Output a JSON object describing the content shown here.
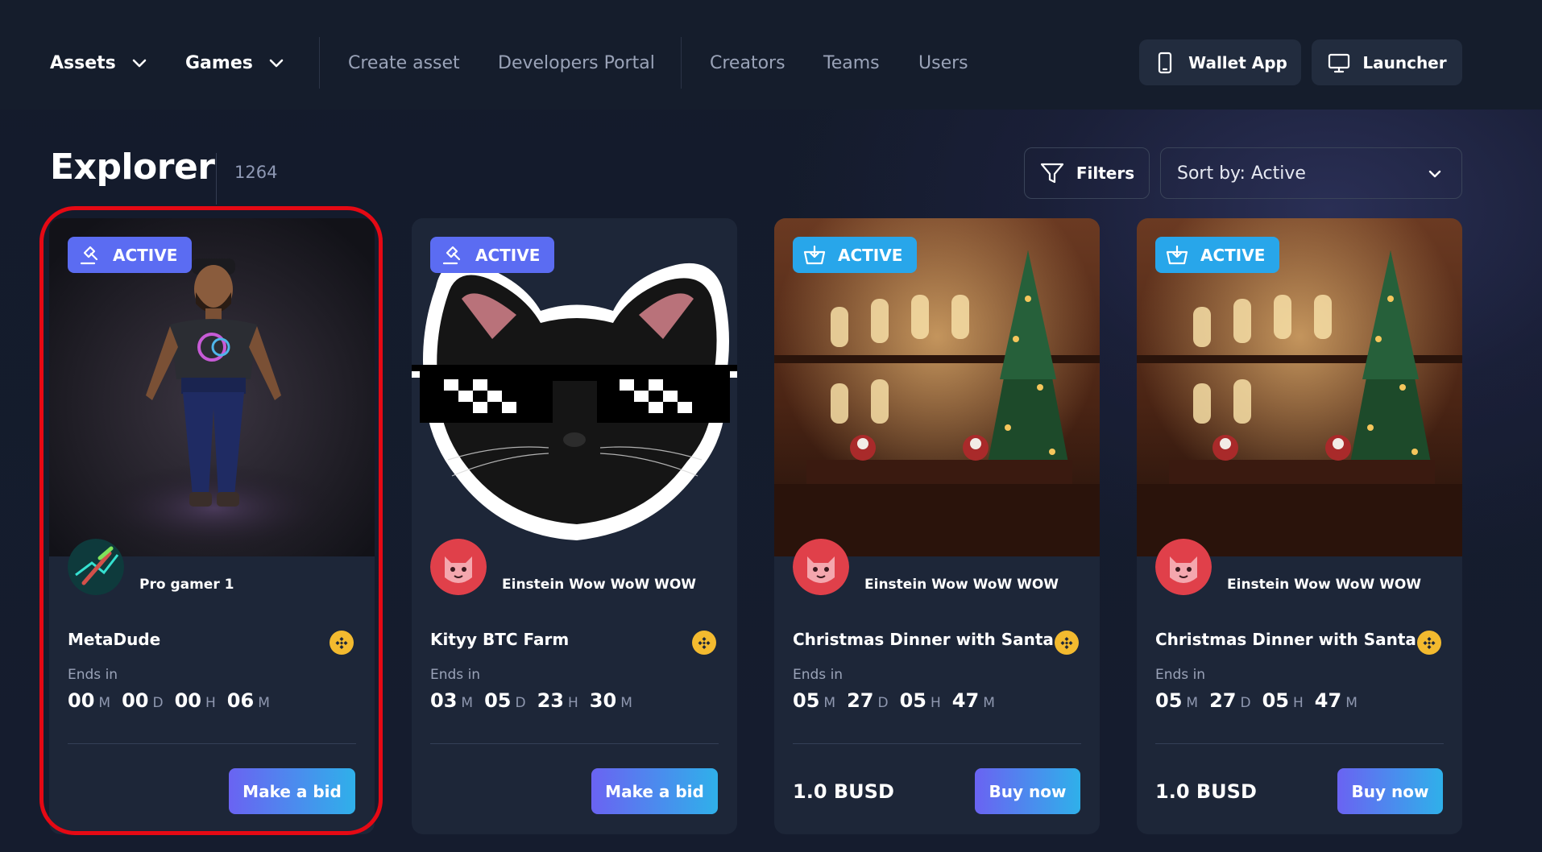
{
  "nav": {
    "primary": [
      {
        "label": "Assets"
      },
      {
        "label": "Games"
      }
    ],
    "secondary": [
      {
        "label": "Create asset"
      },
      {
        "label": "Developers Portal"
      },
      {
        "label": "Creators"
      },
      {
        "label": "Teams"
      },
      {
        "label": "Users"
      }
    ],
    "wallet_label": "Wallet App",
    "launcher_label": "Launcher"
  },
  "header": {
    "title": "Explorer",
    "count": "1264",
    "filters_label": "Filters",
    "sort_label": "Sort by: Active"
  },
  "units": {
    "months": "M",
    "days": "D",
    "hours": "H",
    "minutes": "M"
  },
  "cards": [
    {
      "status": "ACTIVE",
      "status_type": "auction",
      "creator": "Pro gamer 1",
      "name": "MetaDude",
      "ends_label": "Ends in",
      "timer": {
        "months": "00",
        "days": "00",
        "hours": "00",
        "minutes": "06"
      },
      "price": "",
      "action": "Make a bid",
      "currency_icon": "bnb-coin-icon"
    },
    {
      "status": "ACTIVE",
      "status_type": "auction",
      "creator": "Einstein Wow WoW WOW",
      "name": "Kityy BTC Farm",
      "ends_label": "Ends in",
      "timer": {
        "months": "03",
        "days": "05",
        "hours": "23",
        "minutes": "30"
      },
      "price": "",
      "action": "Make a bid",
      "currency_icon": "bnb-coin-icon"
    },
    {
      "status": "ACTIVE",
      "status_type": "sale",
      "creator": "Einstein Wow WoW WOW",
      "name": "Christmas Dinner with Santa...",
      "ends_label": "Ends in",
      "timer": {
        "months": "05",
        "days": "27",
        "hours": "05",
        "minutes": "47"
      },
      "price": "1.0 BUSD",
      "action": "Buy now",
      "currency_icon": "bnb-coin-icon"
    },
    {
      "status": "ACTIVE",
      "status_type": "sale",
      "creator": "Einstein Wow WoW WOW",
      "name": "Christmas Dinner with Santa...",
      "ends_label": "Ends in",
      "timer": {
        "months": "05",
        "days": "27",
        "hours": "05",
        "minutes": "47"
      },
      "price": "1.0 BUSD",
      "action": "Buy now",
      "currency_icon": "bnb-coin-icon"
    }
  ],
  "colors": {
    "background": "#131a2a",
    "card": "#1d2638",
    "auction_badge": "#5b6cf2",
    "sale_badge": "#28a6ea",
    "button_gradient_start": "#6a63f2",
    "button_gradient_end": "#2fb0ea",
    "highlight": "#e50914",
    "coin": "#f3ba2f"
  }
}
